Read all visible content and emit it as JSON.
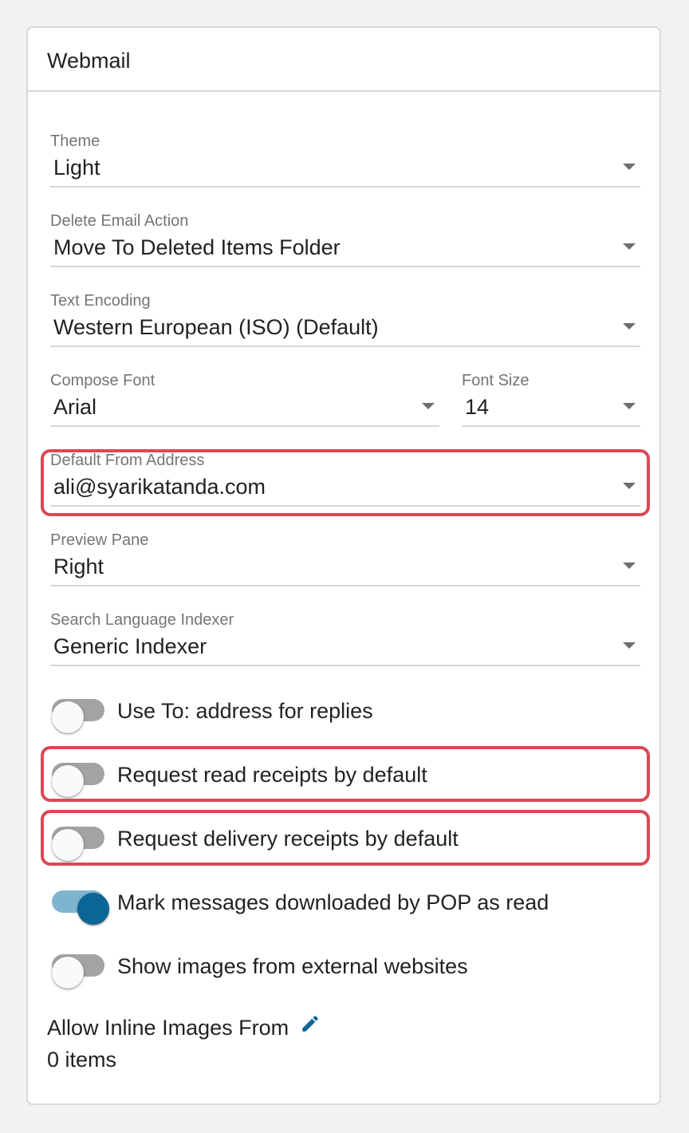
{
  "panel": {
    "title": "Webmail"
  },
  "fields": {
    "theme": {
      "label": "Theme",
      "value": "Light"
    },
    "delete_action": {
      "label": "Delete Email Action",
      "value": "Move To Deleted Items Folder"
    },
    "text_encoding": {
      "label": "Text Encoding",
      "value": "Western European (ISO) (Default)"
    },
    "compose_font": {
      "label": "Compose Font",
      "value": "Arial"
    },
    "font_size": {
      "label": "Font Size",
      "value": "14"
    },
    "default_from": {
      "label": "Default From Address",
      "value": "ali@syarikatanda.com"
    },
    "preview_pane": {
      "label": "Preview Pane",
      "value": "Right"
    },
    "search_indexer": {
      "label": "Search Language Indexer",
      "value": "Generic Indexer"
    }
  },
  "toggles": {
    "use_to_address": {
      "label": "Use To: address for replies",
      "on": false
    },
    "read_receipts": {
      "label": "Request read receipts by default",
      "on": false
    },
    "delivery_receipts": {
      "label": "Request delivery receipts by default",
      "on": false
    },
    "mark_pop_read": {
      "label": "Mark messages downloaded by POP as read",
      "on": true
    },
    "show_external_images": {
      "label": "Show images from external websites",
      "on": false
    }
  },
  "inline_images": {
    "title": "Allow Inline Images From",
    "count": "0 items",
    "edit_icon": "pencil-icon"
  },
  "colors": {
    "accent": "#0b6696",
    "highlight": "#d94a55"
  }
}
